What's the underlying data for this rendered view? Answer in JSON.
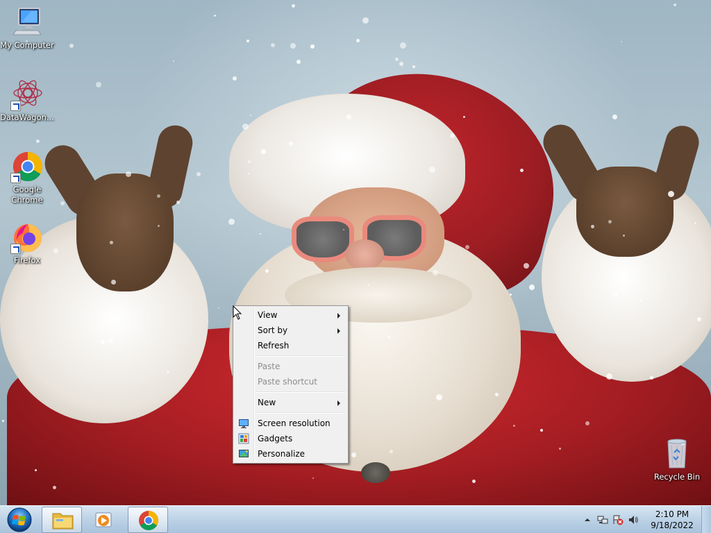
{
  "desktop": {
    "icons": [
      {
        "label": "My Computer",
        "icon": "computer-icon",
        "shortcut": false
      },
      {
        "label": "DataWagon...",
        "icon": "datawagon-icon",
        "shortcut": true
      },
      {
        "label": "Google Chrome",
        "icon": "chrome-icon",
        "shortcut": true
      },
      {
        "label": "Firefox",
        "icon": "firefox-icon",
        "shortcut": true
      },
      {
        "label": "Recycle Bin",
        "icon": "recycle-bin-icon",
        "shortcut": false
      }
    ]
  },
  "context_menu": {
    "items": [
      {
        "label": "View",
        "submenu": true,
        "enabled": true
      },
      {
        "label": "Sort by",
        "submenu": true,
        "enabled": true
      },
      {
        "label": "Refresh",
        "submenu": false,
        "enabled": true
      },
      {
        "label": "Paste",
        "submenu": false,
        "enabled": false
      },
      {
        "label": "Paste shortcut",
        "submenu": false,
        "enabled": false
      },
      {
        "label": "New",
        "submenu": true,
        "enabled": true
      },
      {
        "label": "Screen resolution",
        "icon": "screen-resolution-icon",
        "enabled": true
      },
      {
        "label": "Gadgets",
        "icon": "gadgets-icon",
        "enabled": true
      },
      {
        "label": "Personalize",
        "icon": "personalize-icon",
        "enabled": true
      }
    ]
  },
  "taskbar": {
    "pinned": [
      {
        "name": "Windows Explorer",
        "icon": "folder-icon",
        "active": true
      },
      {
        "name": "Windows Media Player",
        "icon": "media-player-icon",
        "active": false
      },
      {
        "name": "Google Chrome",
        "icon": "chrome-icon",
        "active": true
      }
    ],
    "tray": {
      "time": "2:10 PM",
      "date": "9/18/2022"
    }
  },
  "colors": {
    "menu_bg": "#f0f0f0",
    "taskbar_top": "#d8e6f2",
    "taskbar_bottom": "#a9c3dc"
  }
}
